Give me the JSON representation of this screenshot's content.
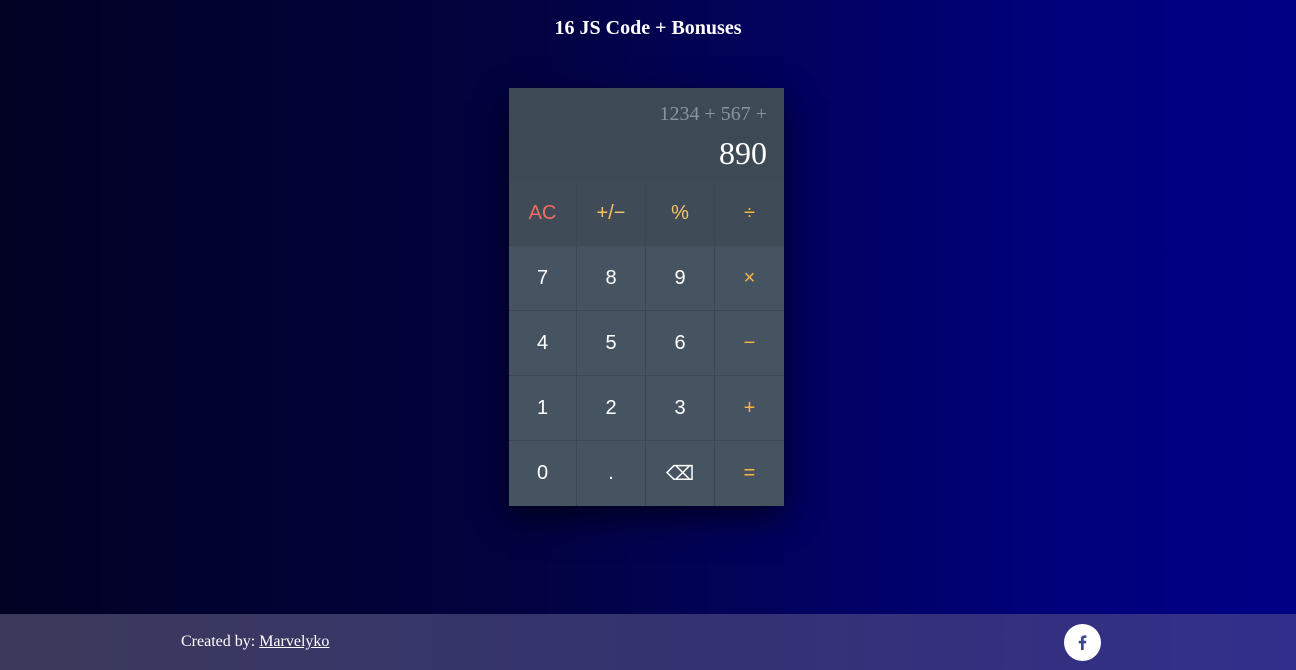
{
  "header": {
    "title": "16 JS Code + Bonuses"
  },
  "calculator": {
    "previous_operand": "1234 + 567 +",
    "current_operand": "890",
    "keys": [
      {
        "label": "AC",
        "kind": "clear"
      },
      {
        "label": "+/−",
        "kind": "func"
      },
      {
        "label": "%",
        "kind": "func"
      },
      {
        "label": "÷",
        "kind": "op"
      },
      {
        "label": "7",
        "kind": "num"
      },
      {
        "label": "8",
        "kind": "num"
      },
      {
        "label": "9",
        "kind": "num"
      },
      {
        "label": "×",
        "kind": "op"
      },
      {
        "label": "4",
        "kind": "num"
      },
      {
        "label": "5",
        "kind": "num"
      },
      {
        "label": "6",
        "kind": "num"
      },
      {
        "label": "−",
        "kind": "op"
      },
      {
        "label": "1",
        "kind": "num"
      },
      {
        "label": "2",
        "kind": "num"
      },
      {
        "label": "3",
        "kind": "num"
      },
      {
        "label": "+",
        "kind": "op"
      },
      {
        "label": "0",
        "kind": "num"
      },
      {
        "label": ".",
        "kind": "num"
      },
      {
        "label": "⌫",
        "kind": "num"
      },
      {
        "label": "=",
        "kind": "op"
      }
    ]
  },
  "footer": {
    "credit_prefix": "Created by: ",
    "author_link": "Marvelyko",
    "social_icon": "facebook-icon"
  },
  "colors": {
    "clear_key": "#f26b61",
    "function_key": "#f6c36a",
    "operator_key": "#f6b640",
    "calculator_body": "#465461",
    "display_background": "#3d4a55"
  }
}
